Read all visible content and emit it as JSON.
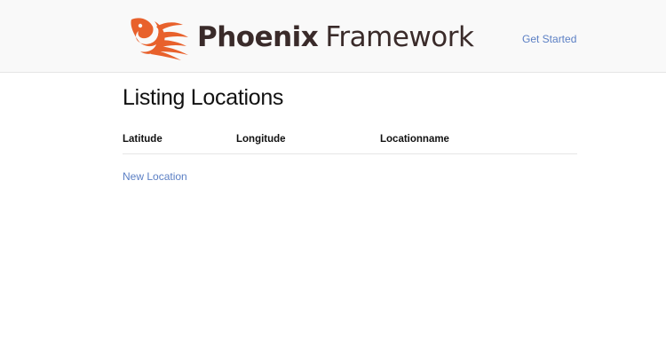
{
  "header": {
    "brand_bold": "Phoenix",
    "brand_light": "Framework",
    "nav_link": "Get Started",
    "logo_color": "#e8612c"
  },
  "main": {
    "title": "Listing Locations",
    "table": {
      "columns": [
        "Latitude",
        "Longitude",
        "Locationname"
      ],
      "rows": []
    },
    "new_link": "New Location",
    "link_color": "#5b7fc4"
  }
}
